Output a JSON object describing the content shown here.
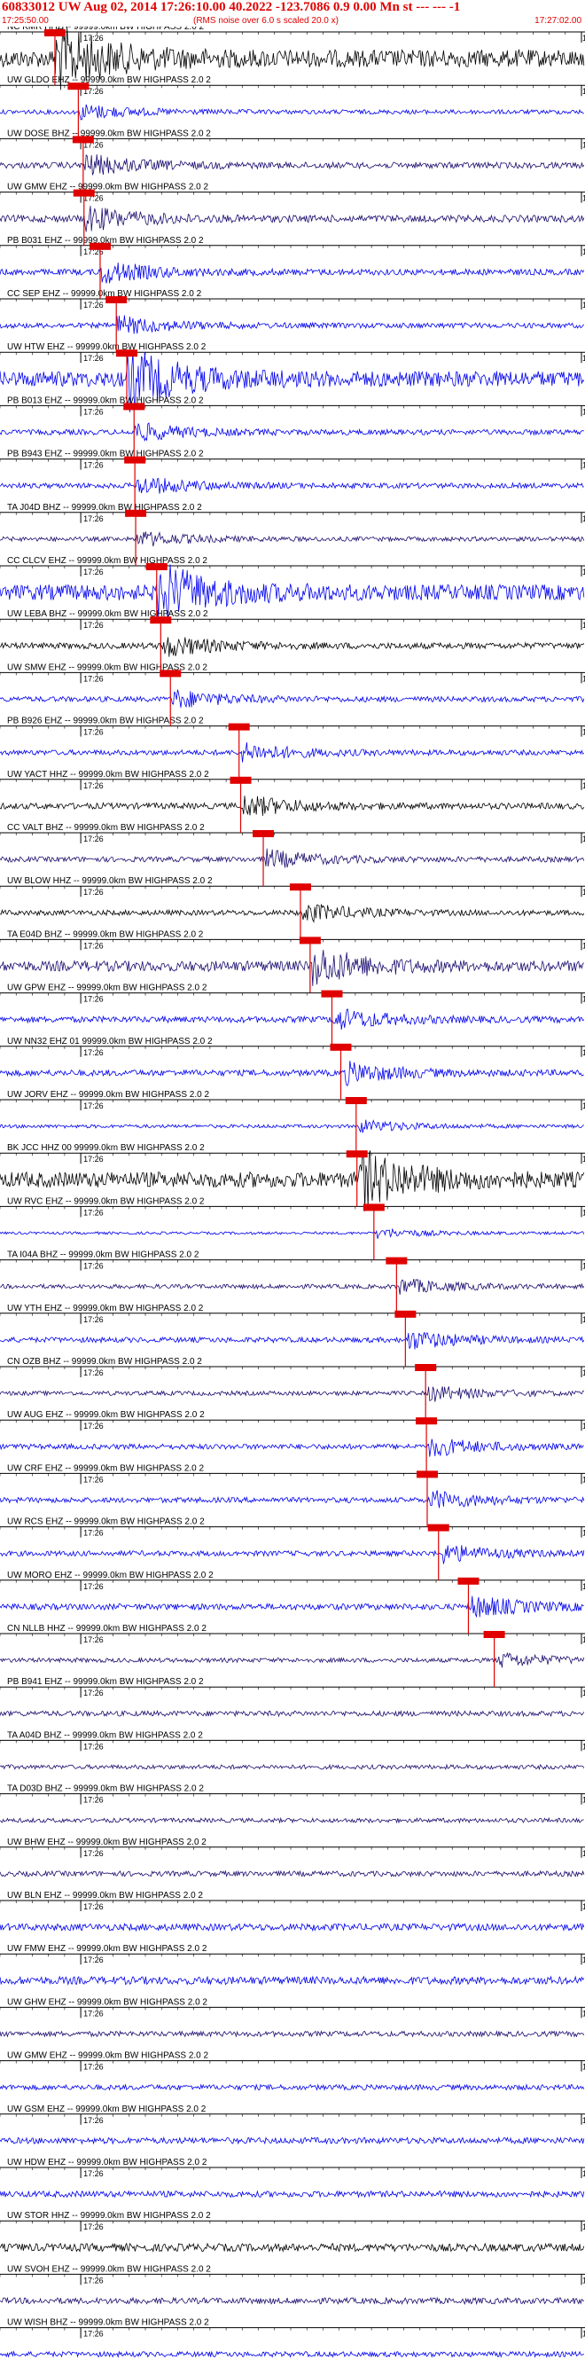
{
  "header": {
    "title": "60833012 UW Aug 02, 2014 17:26:10.00   40.2022 -123.7086  0.9 0.00 Mn st --- --- -1",
    "start_time": "17:25:50.00",
    "note": "(RMS noise over 6.0 s scaled 20.0 x)",
    "end_time": "17:27:02.00"
  },
  "colors": {
    "header": "#e00000",
    "pick": "#e00000",
    "trace_blue": "#0000ee",
    "trace_navy": "#1a0d6e",
    "trace_black": "#000000",
    "axis": "#000000"
  },
  "chart_data": {
    "type": "seismogram",
    "time_range": [
      "17:25:50.00",
      "17:27:02.00"
    ],
    "time_tick_label": "17:26",
    "time_tick_end_label": "17",
    "trace_labels": [
      "NC KMR HHZ -- 99999.0km BW  HIGHPASS  2.0  2",
      "UW GLDO EHZ -- 99999.0km BW  HIGHPASS  2.0  2",
      "UW DOSE BHZ -- 99999.0km BW  HIGHPASS  2.0  2",
      "UW GMW EHZ -- 99999.0km BW  HIGHPASS  2.0  2",
      "PB B031 EHZ -- 99999.0km BW  HIGHPASS  2.0  2",
      "CC SEP EHZ -- 99999.0km BW  HIGHPASS  2.0  2",
      "UW HTW EHZ -- 99999.0km BW  HIGHPASS  2.0  2",
      "PB B013 EHZ -- 99999.0km BW  HIGHPASS  2.0  2",
      "PB B943 EHZ -- 99999.0km BW  HIGHPASS  2.0  2",
      "TA J04D BHZ -- 99999.0km BW  HIGHPASS  2.0  2",
      "CC CLCV EHZ -- 99999.0km BW  HIGHPASS  2.0  2",
      "UW LEBA BHZ -- 99999.0km BW  HIGHPASS  2.0  2",
      "UW SMW EHZ -- 99999.0km BW  HIGHPASS  2.0  2",
      "PB B926 EHZ -- 99999.0km BW  HIGHPASS  2.0  2",
      "UW YACT HHZ -- 99999.0km BW  HIGHPASS  2.0  2",
      "CC VALT BHZ -- 99999.0km BW  HIGHPASS  2.0  2",
      "UW BLOW HHZ -- 99999.0km BW  HIGHPASS  2.0  2",
      "TA E04D BHZ -- 99999.0km BW  HIGHPASS  2.0  2",
      "UW GPW EHZ -- 99999.0km BW  HIGHPASS  2.0  2",
      "UW NN32 EHZ 01 99999.0km BW  HIGHPASS  2.0  2",
      "UW JORV EHZ -- 99999.0km BW  HIGHPASS  2.0  2",
      "BK JCC HHZ 00 99999.0km BW  HIGHPASS  2.0  2",
      "UW RVC EHZ -- 99999.0km BW  HIGHPASS  2.0  2",
      "TA I04A BHZ -- 99999.0km BW  HIGHPASS  2.0  2",
      "UW YTH EHZ -- 99999.0km BW  HIGHPASS  2.0  2",
      "CN OZB BHZ -- 99999.0km BW  HIGHPASS  2.0  2",
      "UW AUG EHZ -- 99999.0km BW  HIGHPASS  2.0  2",
      "UW CRF EHZ -- 99999.0km BW  HIGHPASS  2.0  2",
      "UW RCS EHZ -- 99999.0km BW  HIGHPASS  2.0  2",
      "UW MORO EHZ -- 99999.0km BW  HIGHPASS  2.0  2",
      "CN NLLB HHZ -- 99999.0km BW  HIGHPASS  2.0  2",
      "PB B941 EHZ -- 99999.0km BW  HIGHPASS  2.0  2",
      "TA A04D BHZ -- 99999.0km BW  HIGHPASS  2.0  2",
      "TA D03D BHZ -- 99999.0km BW  HIGHPASS  2.0  2",
      "UW BHW EHZ -- 99999.0km BW  HIGHPASS  2.0  2",
      "UW BLN EHZ -- 99999.0km BW  HIGHPASS  2.0  2",
      "UW FMW EHZ -- 99999.0km BW  HIGHPASS  2.0  2",
      "UW GHW EHZ -- 99999.0km BW  HIGHPASS  2.0  2",
      "UW GMW EHZ -- 99999.0km BW  HIGHPASS  2.0  2",
      "UW GSM EHZ -- 99999.0km BW  HIGHPASS  2.0  2",
      "UW HDW EHZ -- 99999.0km BW  HIGHPASS  2.0  2",
      "UW STOR HHZ -- 99999.0km BW  HIGHPASS  2.0  2",
      "UW SVOH EHZ -- 99999.0km BW  HIGHPASS  2.0  2",
      "UW WISH BHZ -- 99999.0km BW  HIGHPASS  2.0  2"
    ],
    "trace_colors": [
      "black",
      "blue",
      "navy",
      "navy",
      "blue",
      "blue",
      "blue",
      "blue",
      "blue",
      "navy",
      "blue",
      "black",
      "blue",
      "blue",
      "black",
      "navy",
      "black",
      "navy",
      "blue",
      "blue",
      "blue",
      "black",
      "blue",
      "navy",
      "blue",
      "navy",
      "blue",
      "blue",
      "blue",
      "blue",
      "navy",
      "navy",
      "navy",
      "navy",
      "navy",
      "blue",
      "blue",
      "navy",
      "blue",
      "blue",
      "blue",
      "black",
      "navy",
      "blue"
    ],
    "trace_amplitude": [
      1.0,
      0.25,
      0.35,
      0.4,
      0.35,
      0.3,
      0.9,
      0.3,
      0.3,
      0.25,
      0.9,
      0.35,
      0.3,
      0.3,
      0.35,
      0.3,
      0.3,
      0.6,
      0.35,
      0.35,
      0.2,
      0.9,
      0.15,
      0.25,
      0.3,
      0.25,
      0.3,
      0.3,
      0.3,
      0.35,
      0.25,
      0.3,
      0.25,
      0.25,
      0.3,
      0.4,
      0.45,
      0.3,
      0.3,
      0.35,
      0.35,
      0.45,
      0.35,
      0.3
    ],
    "pick_times_s": [
      6.8,
      9.7,
      10.3,
      10.4,
      12.4,
      14.4,
      15.7,
      16.6,
      16.7,
      16.8,
      19.4,
      19.9,
      21.1,
      29.6,
      29.8,
      32.6,
      37.2,
      38.4,
      41.1,
      42.2,
      44.1,
      44.2,
      46.3,
      49.1,
      50.2,
      52.7,
      52.8,
      52.9,
      54.3,
      58.0,
      61.2
    ]
  }
}
